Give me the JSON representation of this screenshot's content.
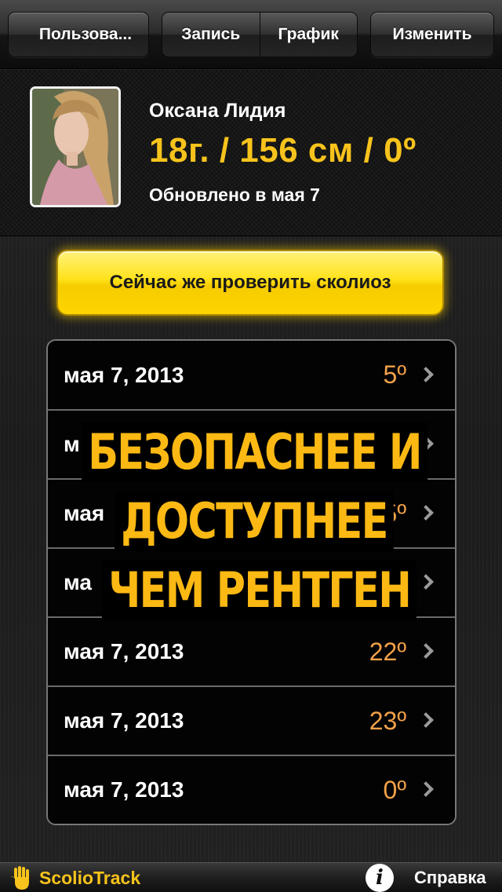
{
  "navbar": {
    "back_label": "Пользова...",
    "segments": [
      {
        "label": "Запись"
      },
      {
        "label": "График"
      }
    ],
    "edit_label": "Изменить"
  },
  "profile": {
    "name": "Оксана Лидия",
    "stats": "18г. / 156 см / 0º",
    "updated": "Обновлено в  мая 7"
  },
  "check_button_label": "Сейчас же проверить сколиоз",
  "history": [
    {
      "date": "мая 7, 2013",
      "angle": "5º"
    },
    {
      "date": "м",
      "angle": ""
    },
    {
      "date": "мая",
      "angle": "5º"
    },
    {
      "date": "ма",
      "angle": ""
    },
    {
      "date": "мая 7, 2013",
      "angle": "22º"
    },
    {
      "date": "мая 7, 2013",
      "angle": "23º"
    },
    {
      "date": "мая 7, 2013",
      "angle": "0º"
    }
  ],
  "promo": {
    "line1": "БЕЗОПАСНЕЕ И",
    "line2": "ДОСТУПНЕЕ",
    "line3": "ЧЕМ РЕНТГЕН"
  },
  "bottombar": {
    "brand": "ScolioTrack",
    "help_label": "Справка"
  },
  "colors": {
    "accent_yellow": "#f7c31c",
    "angle_orange": "#f2a149",
    "promo_yellow": "#fdb913"
  },
  "icons": [
    "back-arrow-icon",
    "chevron-right-icon",
    "hand-logo-icon",
    "info-icon"
  ]
}
